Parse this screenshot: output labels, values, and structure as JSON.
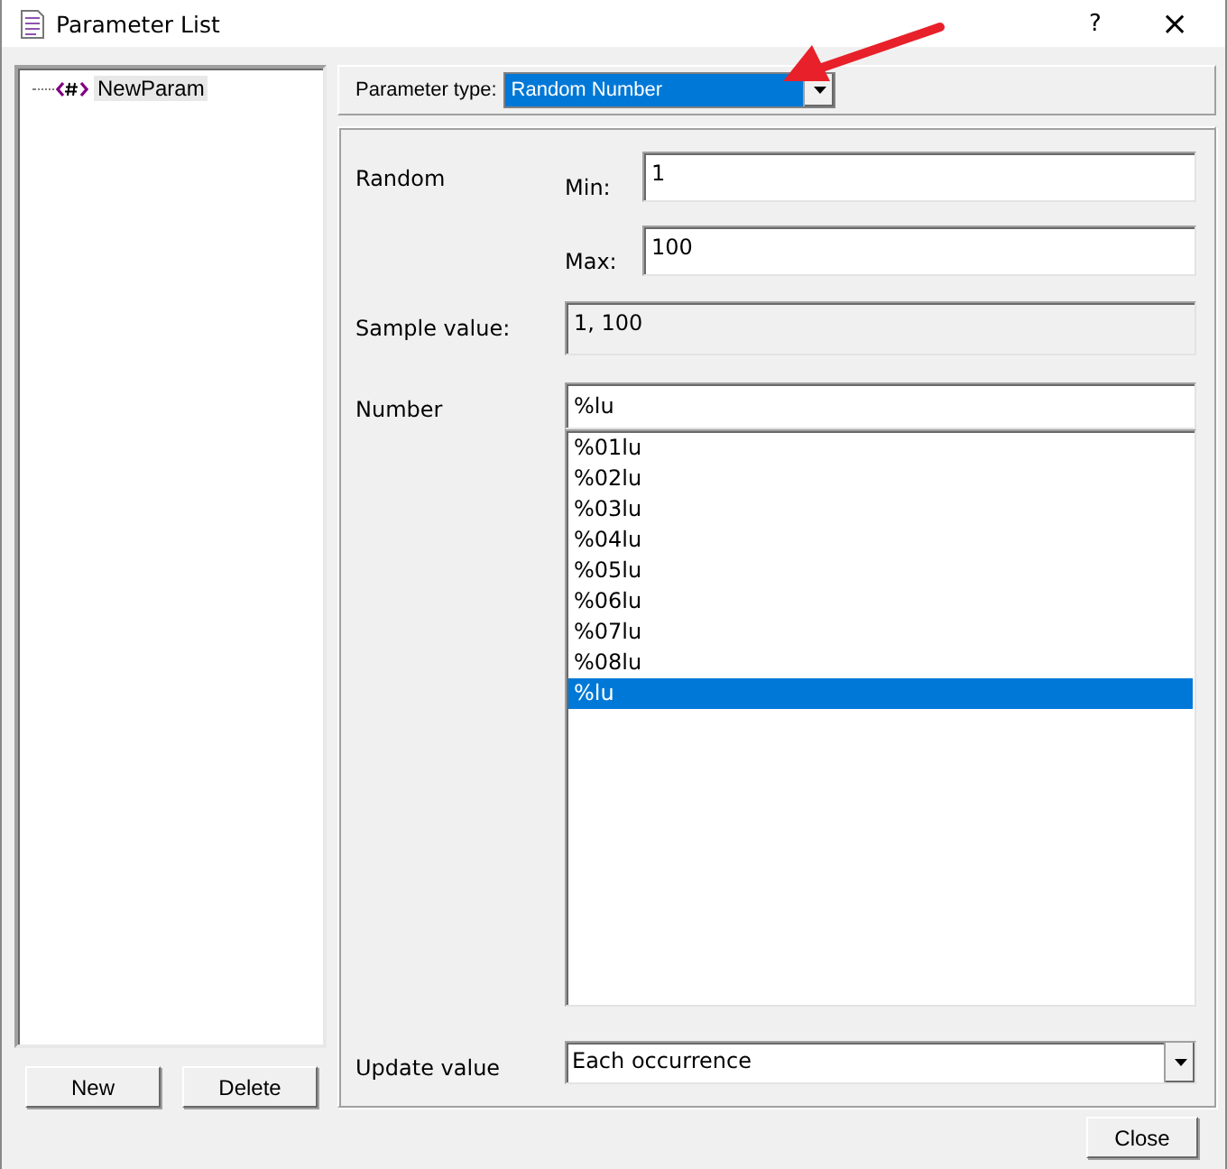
{
  "window": {
    "title": "Parameter List",
    "help": "?",
    "close": "×"
  },
  "tree": [
    {
      "label": "NewParam",
      "selected": true
    }
  ],
  "left_buttons": [
    "New",
    "Delete"
  ],
  "parameter_type": {
    "label": "Parameter type:",
    "value": "Random Number"
  },
  "random": {
    "label": "Random",
    "min_label": "Min:",
    "min": "1",
    "max_label": "Max:",
    "max": "100"
  },
  "sample": {
    "label": "Sample value:",
    "value": "1, 100"
  },
  "number": {
    "label": "Number",
    "value": "%lu",
    "options": [
      {
        "label": "%01lu",
        "selected": false
      },
      {
        "label": "%02lu",
        "selected": false
      },
      {
        "label": "%03lu",
        "selected": false
      },
      {
        "label": "%04lu",
        "selected": false
      },
      {
        "label": "%05lu",
        "selected": false
      },
      {
        "label": "%06lu",
        "selected": false
      },
      {
        "label": "%07lu",
        "selected": false
      },
      {
        "label": "%08lu",
        "selected": false
      },
      {
        "label": "%lu",
        "selected": true
      }
    ]
  },
  "update": {
    "label": "Update value",
    "value": "Each occurrence"
  },
  "close_button": "Close"
}
